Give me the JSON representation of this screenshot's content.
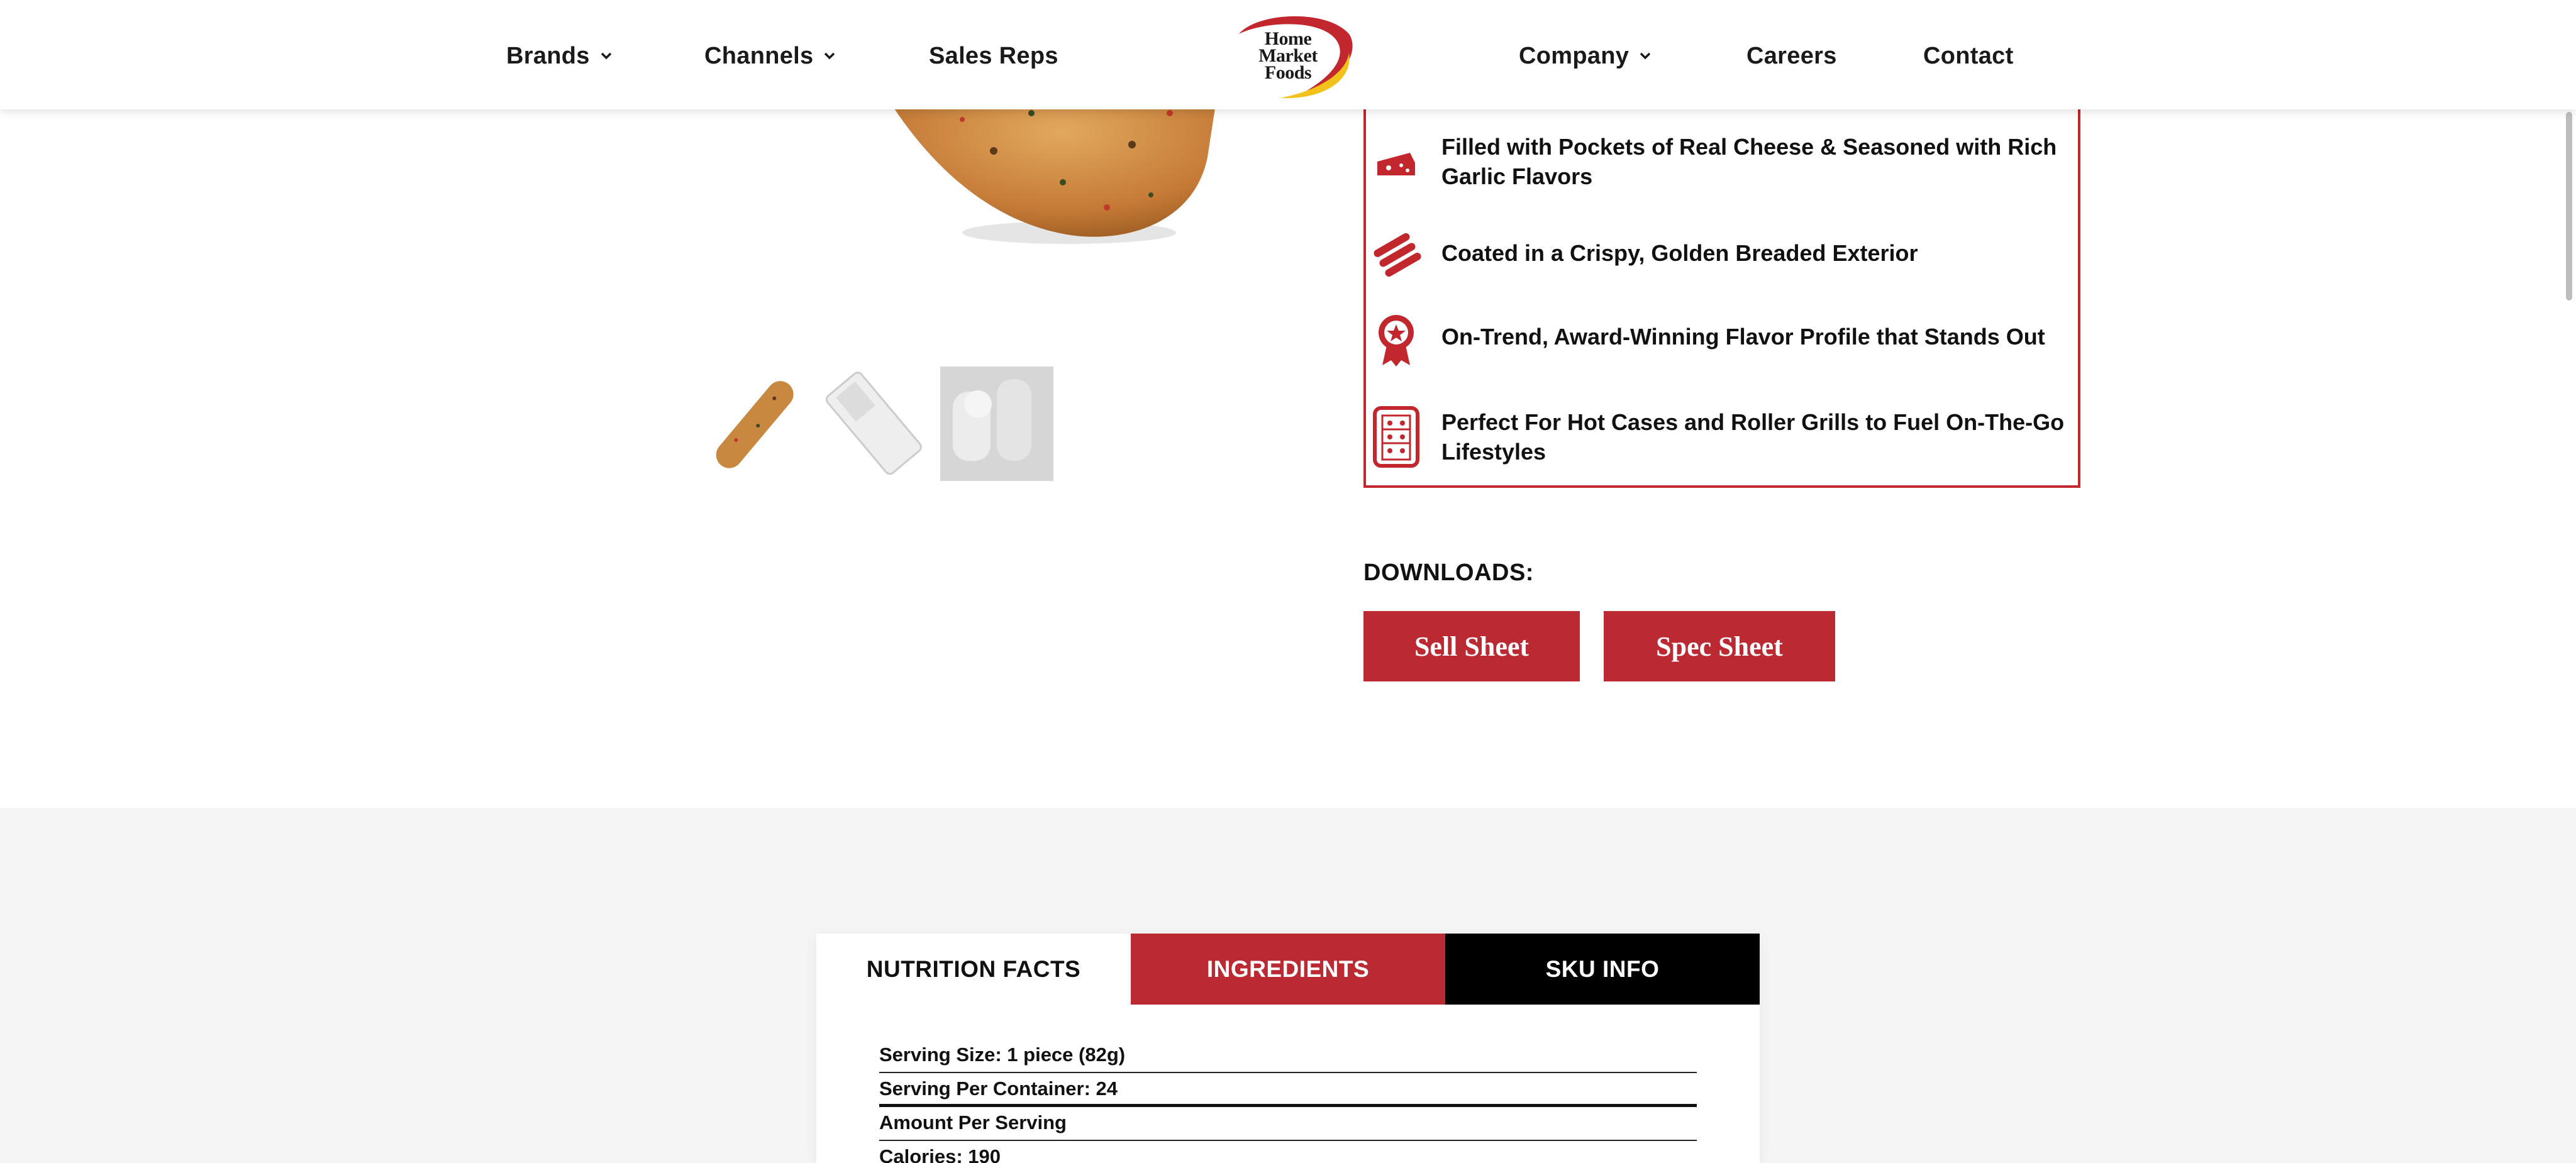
{
  "header": {
    "nav_left": [
      {
        "label": "Brands",
        "has_dropdown": true
      },
      {
        "label": "Channels",
        "has_dropdown": true
      },
      {
        "label": "Sales Reps",
        "has_dropdown": false
      }
    ],
    "logo": {
      "line1": "Home",
      "line2": "Market",
      "line3": "Foods"
    },
    "nav_right": [
      {
        "label": "Company",
        "has_dropdown": true
      },
      {
        "label": "Careers",
        "has_dropdown": false
      },
      {
        "label": "Contact",
        "has_dropdown": false
      }
    ]
  },
  "features": [
    {
      "icon": "cheese-icon",
      "text": "Filled with Pockets of Real Cheese & Seasoned with Rich Garlic Flavors"
    },
    {
      "icon": "breadsticks-icon",
      "text": "Coated in a Crispy, Golden Breaded Exterior"
    },
    {
      "icon": "award-ribbon-icon",
      "text": "On-Trend, Award-Winning Flavor Profile that Stands Out"
    },
    {
      "icon": "hot-case-icon",
      "text": "Perfect For Hot Cases and Roller Grills to Fuel On-The-Go Lifestyles"
    }
  ],
  "downloads": {
    "label": "DOWNLOADS:",
    "sell_sheet": "Sell Sheet",
    "spec_sheet": "Spec Sheet"
  },
  "tabs": {
    "nutrition": "NUTRITION FACTS",
    "ingredients": "INGREDIENTS",
    "sku": "SKU INFO"
  },
  "nutrition": {
    "serving_size": "Serving Size: 1 piece (82g)",
    "servings_per_container": "Serving Per Container: 24",
    "amount_per_serving": "Amount Per Serving",
    "calories": "Calories: 190"
  },
  "colors": {
    "brand_red": "#bb2933",
    "tab_black": "#000000",
    "section_grey": "#f5f5f5"
  }
}
